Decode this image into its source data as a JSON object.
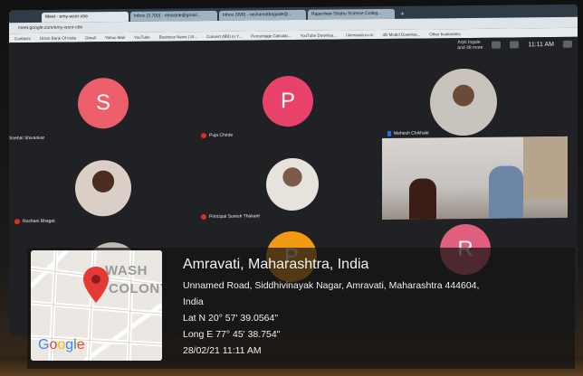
{
  "browser": {
    "tabs": [
      {
        "label": "Meet - emy-wsnr-cbe",
        "active": true
      },
      {
        "label": "Inbox (3,700) - mhaskle@gmail..."
      },
      {
        "label": "Inbox (999) - rashamdtbagade@..."
      },
      {
        "label": "Rajarshee Shahu Science Colleg..."
      }
    ],
    "url": "meet.google.com/emy-wsnr-cbe",
    "bookmarks": [
      "Contacts",
      "Union Bank Of India",
      "Gmail",
      "Yahoo Mail",
      "YouTube",
      "Business News | St...",
      "Convert (MB) to Y...",
      "Percentage Calculat...",
      "YouTube Downloa...",
      "I Amravati.co.in",
      "3D Model Downloa...",
      "Other bookmarks"
    ]
  },
  "meet": {
    "presenter_label": "Arpit Ingale",
    "presenter_sublabel": "and 48 more",
    "time": "11:11 AM",
    "participants": [
      {
        "letter": "S",
        "name": "Snehal Shivankar",
        "color": "#ec5f6b"
      },
      {
        "letter": "P",
        "name": "Puja Chirde",
        "color": "#e8426b"
      },
      {
        "name": "Mahesh Chikhale"
      },
      {
        "name": "Roshani Bhagat"
      },
      {
        "name": "Principal Suresh Thakare"
      },
      {
        "letter": "P",
        "color": "#f29a12"
      },
      {
        "letter": "R",
        "color": "#e05f7e"
      }
    ]
  },
  "gps": {
    "map_label_1": "WASH",
    "map_label_2": "COLONY",
    "google": "Google",
    "title": "Amravati, Maharashtra, India",
    "address_1": "Unnamed Road, Siddhivinayak Nagar, Amravati, Maharashtra 444604,",
    "address_2": "India",
    "lat": "Lat N 20° 57' 39.0564\"",
    "long": "Long E 77° 45' 38.754\"",
    "datetime": "28/02/21 11:11 AM"
  }
}
